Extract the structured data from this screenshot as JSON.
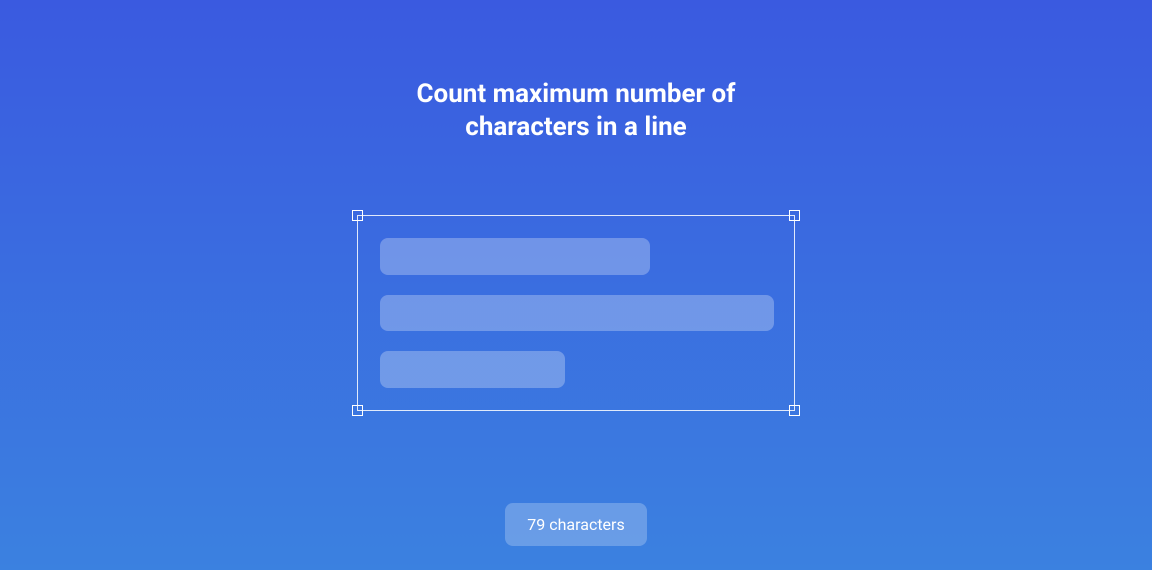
{
  "title": "Count maximum number of characters in a line",
  "selection": {
    "bars": [
      {
        "widthPercent": 62
      },
      {
        "widthPercent": 90
      },
      {
        "widthPercent": 42
      }
    ]
  },
  "badge": {
    "label": "79 characters"
  }
}
